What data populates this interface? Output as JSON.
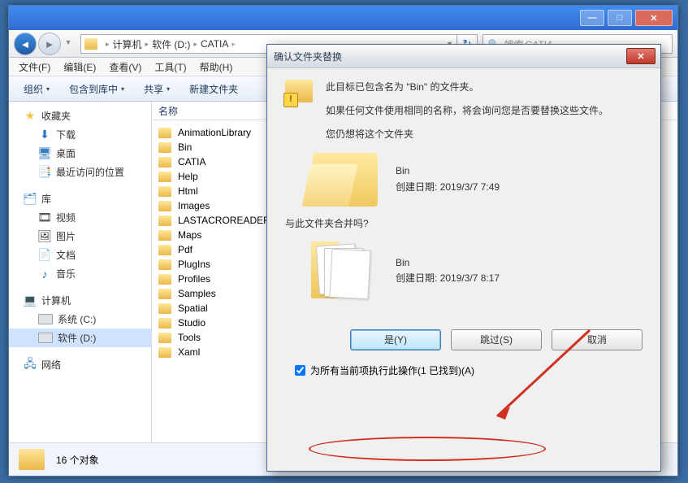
{
  "window": {
    "min_tooltip": "Minimize",
    "max_tooltip": "Maximize",
    "close_tooltip": "Close"
  },
  "address": {
    "segs": [
      "计算机",
      "软件 (D:)",
      "CATIA"
    ]
  },
  "search": {
    "placeholder": "搜索 CATIA"
  },
  "menus": {
    "file": "文件(F)",
    "edit": "编辑(E)",
    "view": "查看(V)",
    "tools": "工具(T)",
    "help": "帮助(H)"
  },
  "toolbar": {
    "organize": "组织",
    "include": "包含到库中",
    "share": "共享",
    "newfolder": "新建文件夹"
  },
  "column": {
    "name": "名称"
  },
  "sidebar": {
    "favorites": "收藏夹",
    "downloads": "下载",
    "desktop": "桌面",
    "recent": "最近访问的位置",
    "libraries": "库",
    "videos": "视频",
    "pictures": "图片",
    "documents": "文档",
    "music": "音乐",
    "computer": "计算机",
    "drive_c": "系统 (C:)",
    "drive_d": "软件 (D:)",
    "network": "网络"
  },
  "files": [
    "AnimationLibrary",
    "Bin",
    "CATIA",
    "Help",
    "Html",
    "Images",
    "LASTACROREADERU",
    "Maps",
    "Pdf",
    "PlugIns",
    "Profiles",
    "Samples",
    "Spatial",
    "Studio",
    "Tools",
    "Xaml"
  ],
  "status": {
    "count": "16 个对象"
  },
  "dialog": {
    "title": "确认文件夹替换",
    "line1": "此目标已包含名为 \"Bin\" 的文件夹。",
    "line2": "如果任何文件使用相同的名称，将会询问您是否要替换这些文件。",
    "line3": "您仍想将这个文件夹",
    "item1": {
      "name": "Bin",
      "date": "创建日期: 2019/3/7 7:49"
    },
    "merge_q": "与此文件夹合并吗?",
    "item2": {
      "name": "Bin",
      "date": "创建日期: 2019/3/7 8:17"
    },
    "yes": "是(Y)",
    "skip": "跳过(S)",
    "cancel": "取消",
    "checkbox": "为所有当前项执行此操作(1 已找到)(A)"
  }
}
